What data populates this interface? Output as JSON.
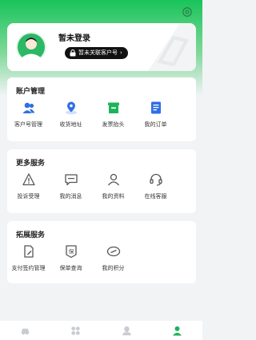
{
  "colors": {
    "accent": "#18c45a",
    "icon_blue": "#2f6fe4",
    "icon_green": "#1db35c",
    "icon_gray": "#555555"
  },
  "profile": {
    "title": "暂未登录",
    "bind_label": "暂未关联客户号",
    "bind_chevron": "›"
  },
  "sections": [
    {
      "title": "账户管理",
      "items": [
        {
          "label": "客户号管理",
          "icon": "users-icon"
        },
        {
          "label": "收货地址",
          "icon": "location-pin-icon"
        },
        {
          "label": "发票抬头",
          "icon": "invoice-icon"
        },
        {
          "label": "我的订单",
          "icon": "orders-icon"
        }
      ]
    },
    {
      "title": "更多服务",
      "items": [
        {
          "label": "投诉受理",
          "icon": "complaint-icon"
        },
        {
          "label": "我的消息",
          "icon": "message-icon"
        },
        {
          "label": "我的资料",
          "icon": "profile-icon"
        },
        {
          "label": "在线客服",
          "icon": "headset-icon"
        }
      ]
    },
    {
      "title": "拓展服务",
      "items": [
        {
          "label": "支付签约管理",
          "icon": "contract-icon"
        },
        {
          "label": "保单查询",
          "icon": "insurance-icon"
        },
        {
          "label": "我的积分",
          "icon": "points-icon"
        }
      ]
    }
  ],
  "tabbar": [
    {
      "name": "tab-car",
      "icon": "car-icon",
      "active": false
    },
    {
      "name": "tab-services",
      "icon": "grid-icon",
      "active": false
    },
    {
      "name": "tab-map",
      "icon": "map-icon",
      "active": false
    },
    {
      "name": "tab-mine",
      "icon": "person-icon",
      "active": true
    }
  ]
}
